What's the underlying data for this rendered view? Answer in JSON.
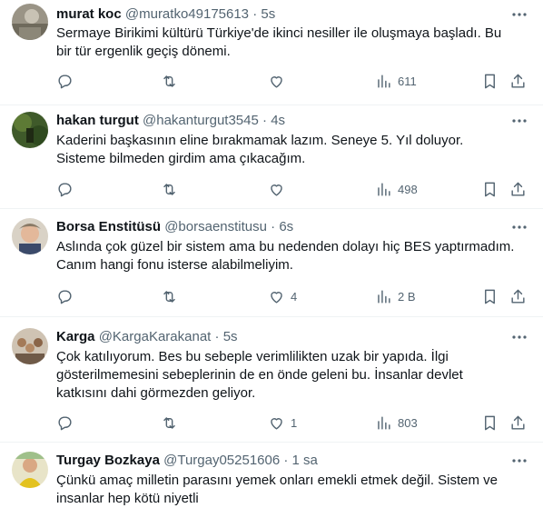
{
  "tweets": [
    {
      "name": "murat koc",
      "handle": "@muratko49175613",
      "dot": "·",
      "time": "5s",
      "text": "Sermaye Birikimi kültürü Türkiye'de ikinci nesiller ile oluşmaya başladı. Bu bir tür ergenlik geçiş dönemi.",
      "likes": "",
      "views": "611"
    },
    {
      "name": "hakan turgut",
      "handle": "@hakanturgut3545",
      "dot": "·",
      "time": "4s",
      "text": "Kaderini başkasının eline bırakmamak lazım.  Seneye 5. Yıl doluyor. Sisteme bilmeden girdim ama çıkacağım.",
      "likes": "",
      "views": "498"
    },
    {
      "name": "Borsa Enstitüsü",
      "handle": "@borsaenstitusu",
      "dot": "·",
      "time": "6s",
      "text": "Aslında çok güzel bir sistem ama bu nedenden dolayı hiç BES yaptırmadım. Canım hangi fonu isterse alabilmeliyim.",
      "likes": "4",
      "views": "2 B"
    },
    {
      "name": "Karga",
      "handle": "@KargaKarakanat",
      "dot": "·",
      "time": "5s",
      "text": "Çok katılıyorum. Bes bu sebeple verimlilikten uzak bir yapıda. İlgi gösterilmemesini sebeplerinin de en önde geleni bu. İnsanlar devlet katkısını dahi görmezden geliyor.",
      "likes": "1",
      "views": "803"
    },
    {
      "name": "Turgay Bozkaya",
      "handle": "@Turgay05251606",
      "dot": "·",
      "time": "1 sa",
      "text": "Çünkü amaç milletin parasını yemek onları emekli etmek değil. Sistem ve insanlar hep kötü niyetli",
      "likes": "",
      "views": ""
    }
  ],
  "icons": {
    "more": "more-icon",
    "reply": "reply-icon",
    "retweet": "retweet-icon",
    "like": "heart-icon",
    "views": "views-icon",
    "bookmark": "bookmark-icon",
    "share": "share-icon"
  },
  "colors": {
    "text": "#0f1419",
    "secondary": "#536471",
    "divider": "#eff3f4"
  }
}
